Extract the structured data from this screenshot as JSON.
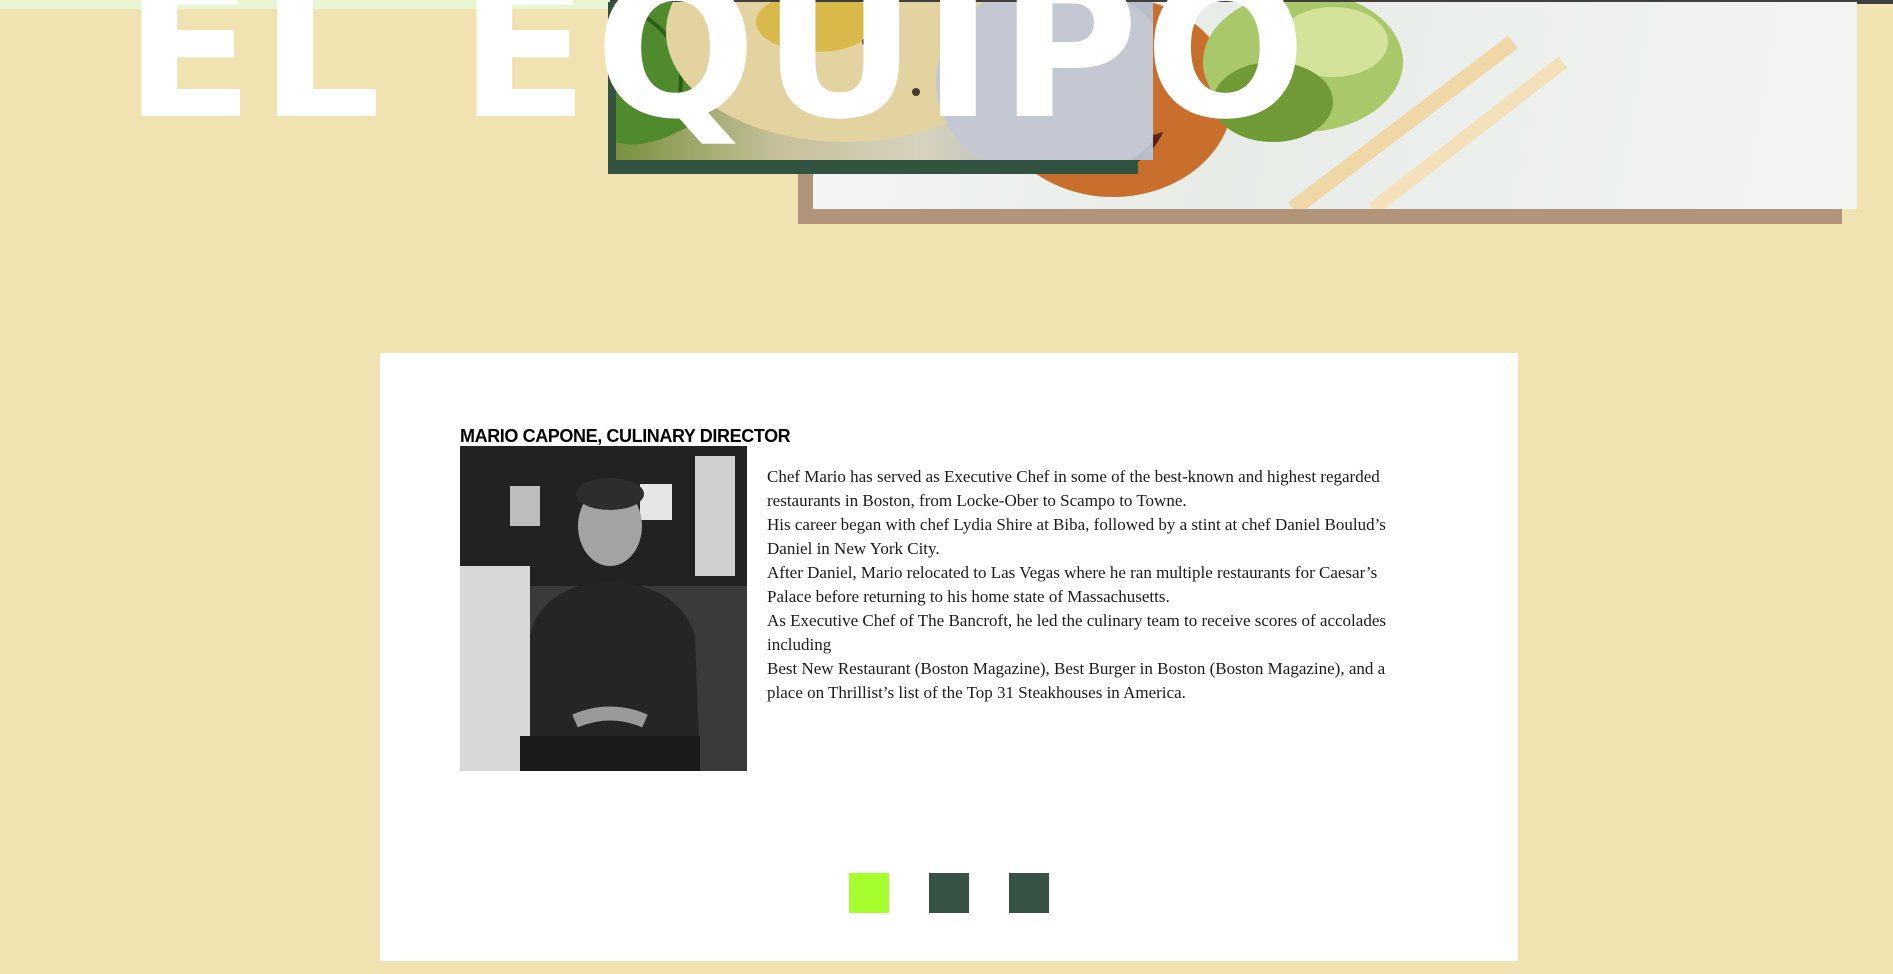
{
  "hero": {
    "title": "EL EQUIPO"
  },
  "team": {
    "member": {
      "name": "MARIO CAPONE, CULINARY DIRECTOR",
      "bio": [
        "Chef Mario has served as Executive Chef in some of the best-known and highest regarded restaurants in Boston, from Locke-Ober to Scampo to Towne.",
        "His career began with chef Lydia Shire at Biba, followed by a stint at chef Daniel Boulud’s Daniel in New York City.",
        "After Daniel, Mario relocated to Las Vegas where he ran multiple restaurants for Caesar’s Palace before returning to his home state of Massachusetts.",
        "As Executive Chef of The Bancroft, he led the culinary team to receive scores of accolades including",
        "Best New Restaurant (Boston Magazine), Best Burger in Boston (Boston Magazine), and a place on Thrillist’s list of the Top 31 Steakhouses in America."
      ]
    },
    "slider": {
      "active_index": 0,
      "count": 3
    }
  },
  "colors": {
    "background": "#f1e2b1",
    "dark_green": "#365244",
    "lime_active": "#a6ff2d",
    "shadow_brown": "#b0957a"
  }
}
